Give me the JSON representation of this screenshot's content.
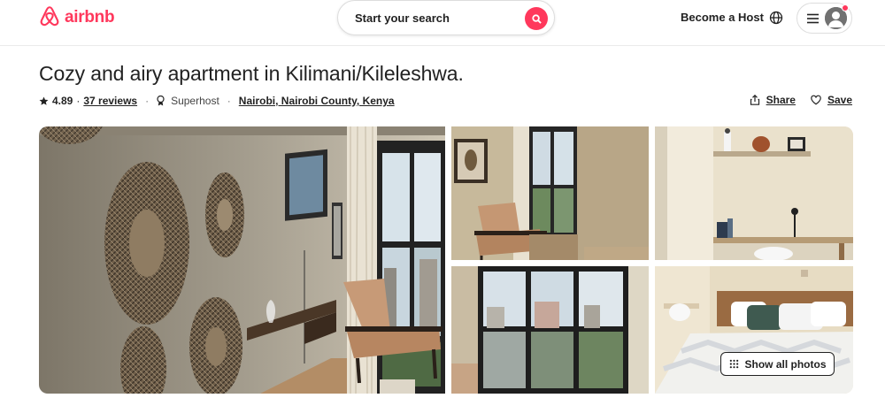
{
  "header": {
    "logo_text": "airbnb",
    "search_label": "Start your search",
    "become_host": "Become a Host"
  },
  "listing": {
    "title": "Cozy and airy apartment in Kilimani/Kileleshwa.",
    "rating": "4.89",
    "reviews": "37 reviews",
    "superhost": "Superhost",
    "location": "Nairobi, Nairobi County, Kenya",
    "share": "Share",
    "save": "Save"
  },
  "gallery": {
    "show_all": "Show all photos"
  },
  "colors": {
    "brand": "#ff385c",
    "text": "#222222",
    "border": "#dddddd"
  },
  "icons": [
    "airbnb-logo-icon",
    "search-icon",
    "globe-icon",
    "menu-icon",
    "avatar-icon",
    "star-icon",
    "superhost-icon",
    "share-icon",
    "heart-icon",
    "grid-icon"
  ]
}
